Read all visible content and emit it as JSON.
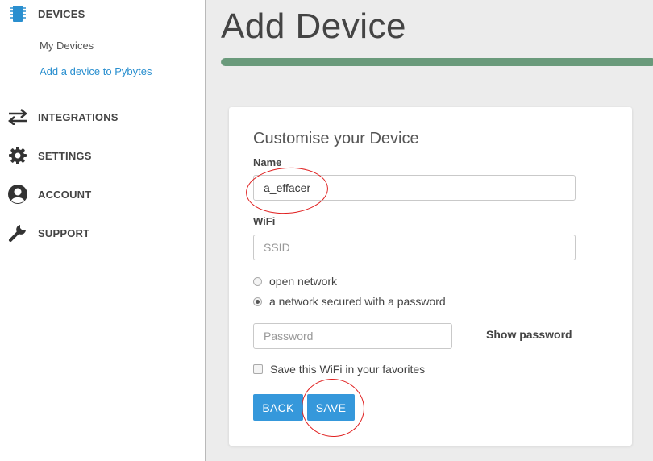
{
  "sidebar": {
    "devices_label": "DEVICES",
    "devices_sub": [
      "My Devices",
      "Add a device to Pybytes"
    ],
    "integrations_label": "INTEGRATIONS",
    "settings_label": "SETTINGS",
    "account_label": "ACCOUNT",
    "support_label": "SUPPORT",
    "icons": [
      "chip-icon",
      "swap-arrows-icon",
      "gear-icon",
      "user-icon",
      "wrench-icon"
    ]
  },
  "header": {
    "title": "Add Device",
    "progress_fraction": 1.0
  },
  "form": {
    "title": "Customise your Device",
    "name_label": "Name",
    "name_value": "a_effacer",
    "wifi_label": "WiFi",
    "ssid_placeholder": "SSID",
    "radio_open": "open network",
    "radio_secured": "a network secured with a password",
    "password_placeholder": "Password",
    "show_password": "Show password",
    "save_favorite": "Save this WiFi in your favorites",
    "back_label": "BACK",
    "save_label": "SAVE"
  },
  "colors": {
    "accent_blue": "#3598db",
    "progress_green": "#6a9a7b",
    "annotation_red": "#e02020"
  }
}
